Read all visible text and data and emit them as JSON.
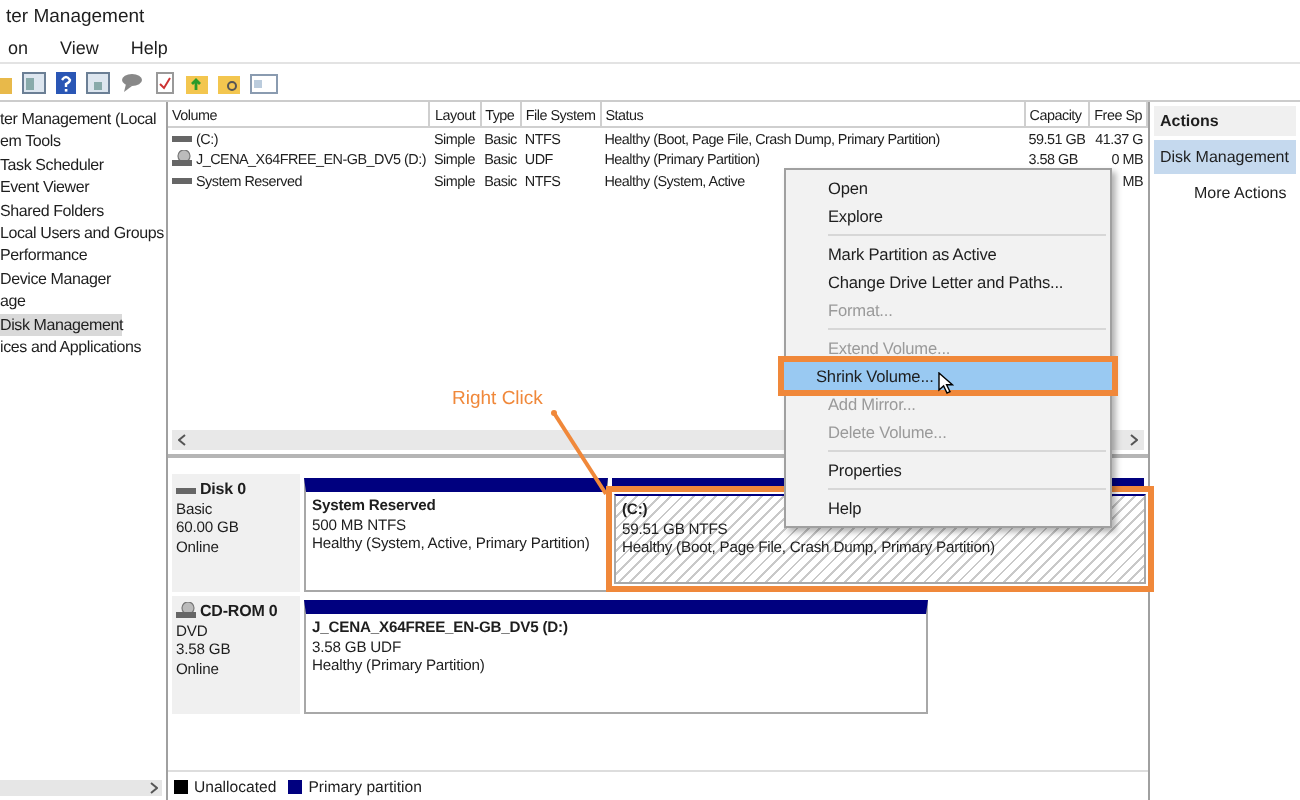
{
  "window": {
    "title": "ter Management"
  },
  "menu": [
    "on",
    "View",
    "Help"
  ],
  "tree": {
    "items": [
      {
        "label": "ter Management (Local",
        "selected": false
      },
      {
        "label": "em Tools",
        "selected": false
      },
      {
        "label": "Task Scheduler",
        "selected": false
      },
      {
        "label": "Event Viewer",
        "selected": false
      },
      {
        "label": "Shared Folders",
        "selected": false
      },
      {
        "label": "Local Users and Groups",
        "selected": false
      },
      {
        "label": "Performance",
        "selected": false
      },
      {
        "label": "Device Manager",
        "selected": false
      },
      {
        "label": "age",
        "selected": false
      },
      {
        "label": "Disk Management",
        "selected": true
      },
      {
        "label": "ices and Applications",
        "selected": false
      }
    ]
  },
  "volumes": {
    "columns": [
      "Volume",
      "Layout",
      "Type",
      "File System",
      "Status",
      "Capacity",
      "Free Sp"
    ],
    "rows": [
      {
        "kind": "disk",
        "volume": "(C:)",
        "layout": "Simple",
        "type": "Basic",
        "file_system": "NTFS",
        "status": "Healthy (Boot, Page File, Crash Dump, Primary Partition)",
        "capacity": "59.51 GB",
        "free_space": "41.37 G"
      },
      {
        "kind": "cd",
        "volume": "J_CENA_X64FREE_EN-GB_DV5 (D:)",
        "layout": "Simple",
        "type": "Basic",
        "file_system": "UDF",
        "status": "Healthy (Primary Partition)",
        "capacity": "3.58 GB",
        "free_space": "0 MB"
      },
      {
        "kind": "disk",
        "volume": "System Reserved",
        "layout": "Simple",
        "type": "Basic",
        "file_system": "NTFS",
        "status": "Healthy (System, Active",
        "free_space": "MB"
      }
    ]
  },
  "disks": [
    {
      "kind": "disk",
      "name": "Disk 0",
      "details": [
        "Basic",
        "60.00 GB",
        "Online"
      ],
      "partitions": [
        {
          "name": "System Reserved",
          "size": "500 MB NTFS",
          "status": "Healthy (System, Active, Primary Partition)",
          "selected": false,
          "highlighted": false
        },
        {
          "name": "(C:)",
          "size": "59.51 GB NTFS",
          "status": "Healthy (Boot, Page File, Crash Dump, Primary Partition)",
          "selected": true,
          "highlighted": true
        }
      ]
    },
    {
      "kind": "cd",
      "name": "CD-ROM 0",
      "details": [
        "DVD",
        "3.58 GB",
        "Online"
      ],
      "partitions": [
        {
          "name": "J_CENA_X64FREE_EN-GB_DV5  (D:)",
          "size": "3.58 GB UDF",
          "status": "Healthy (Primary Partition)",
          "selected": false,
          "highlighted": false
        }
      ]
    }
  ],
  "legend": [
    {
      "label": "Unallocated",
      "color": "#000000"
    },
    {
      "label": "Primary partition",
      "color": "#00007f"
    }
  ],
  "actions": {
    "title": "Actions",
    "items": [
      {
        "kind": "section",
        "label": "Disk Management",
        "selected": true
      },
      {
        "kind": "action",
        "label": "More Actions",
        "selected": false
      }
    ]
  },
  "context_menu": {
    "items": [
      {
        "kind": "item",
        "label": "Open",
        "disabled": false,
        "selected": false,
        "highlighted": false
      },
      {
        "kind": "item",
        "label": "Explore",
        "disabled": false,
        "selected": false,
        "highlighted": false
      },
      {
        "kind": "separator"
      },
      {
        "kind": "item",
        "label": "Mark Partition as Active",
        "disabled": false,
        "selected": false,
        "highlighted": false
      },
      {
        "kind": "item",
        "label": "Change Drive Letter and Paths...",
        "disabled": false,
        "selected": false,
        "highlighted": false
      },
      {
        "kind": "item",
        "label": "Format...",
        "disabled": true,
        "selected": false,
        "highlighted": false
      },
      {
        "kind": "separator"
      },
      {
        "kind": "item",
        "label": "Extend Volume...",
        "disabled": true,
        "selected": false,
        "highlighted": false
      },
      {
        "kind": "item",
        "label": "Shrink Volume...",
        "disabled": false,
        "selected": true,
        "highlighted": true
      },
      {
        "kind": "item",
        "label": "Add Mirror...",
        "disabled": true,
        "selected": false,
        "highlighted": false
      },
      {
        "kind": "item",
        "label": "Delete Volume...",
        "disabled": true,
        "selected": false,
        "highlighted": false
      },
      {
        "kind": "separator"
      },
      {
        "kind": "item",
        "label": "Properties",
        "disabled": false,
        "selected": false,
        "highlighted": false
      },
      {
        "kind": "separator"
      },
      {
        "kind": "item",
        "label": "Help",
        "disabled": false,
        "selected": false,
        "highlighted": false
      }
    ]
  },
  "annotation": {
    "label": "Right Click"
  }
}
